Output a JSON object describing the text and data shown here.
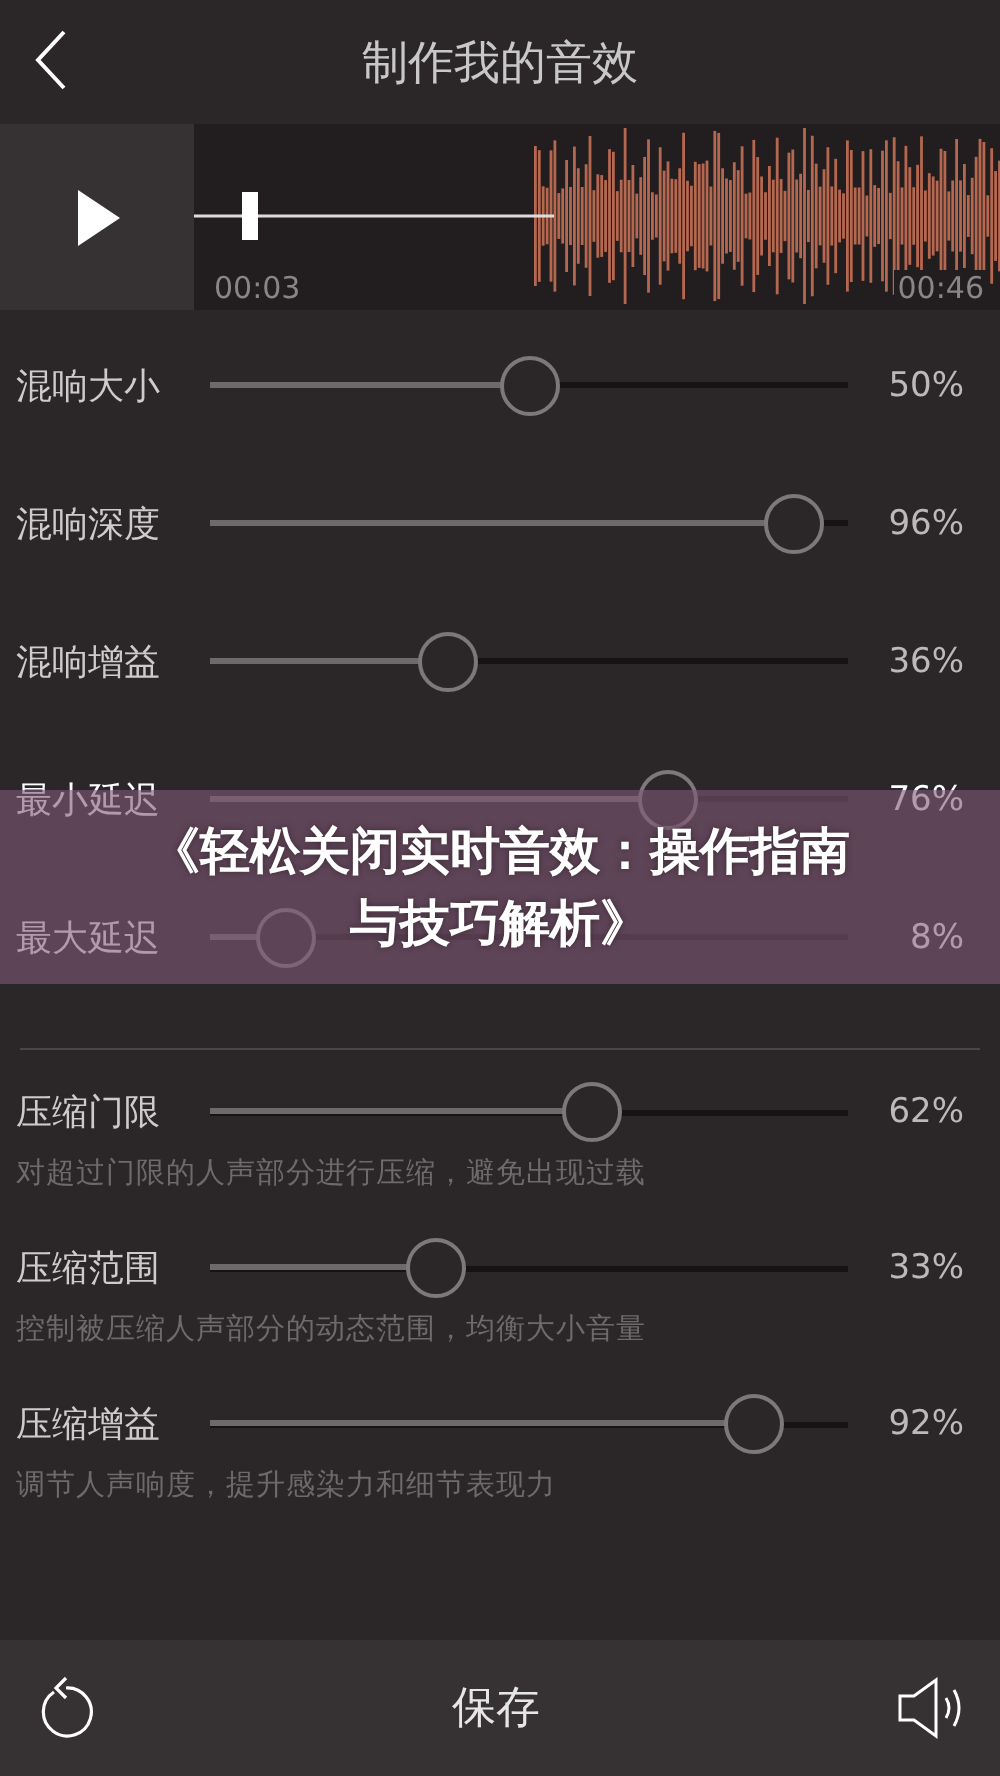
{
  "header": {
    "title": "制作我的音效"
  },
  "player": {
    "playing": false,
    "start_time": "00:03",
    "end_time": "00:46"
  },
  "reverb": [
    {
      "label": "混响大小",
      "level": 0.5,
      "reading": "50%"
    },
    {
      "label": "混响深度",
      "level": 0.96,
      "reading": "96%"
    },
    {
      "label": "混响增益",
      "level": 0.36,
      "reading": "36%"
    },
    {
      "label": "最小延迟",
      "level": 0.74,
      "reading": "76%"
    },
    {
      "label": "最大延迟",
      "level": 0.08,
      "reading": "8%"
    }
  ],
  "compression": [
    {
      "label": "压缩门限",
      "level": 0.61,
      "reading": "62%",
      "description": "对超过门限的人声部分进行压缩，避免出现过载"
    },
    {
      "label": "压缩范围",
      "level": 0.34,
      "reading": "33%",
      "description": "控制被压缩人声部分的动态范围，均衡大小音量"
    },
    {
      "label": "压缩增益",
      "level": 0.89,
      "reading": "92%",
      "description": "调节人声响度，提升感染力和细节表现力"
    }
  ],
  "overlay_title": [
    "《轻松关闭实时音效：操作指南",
    "与技巧解析》"
  ],
  "bottom_bar": {
    "save": "保存"
  }
}
